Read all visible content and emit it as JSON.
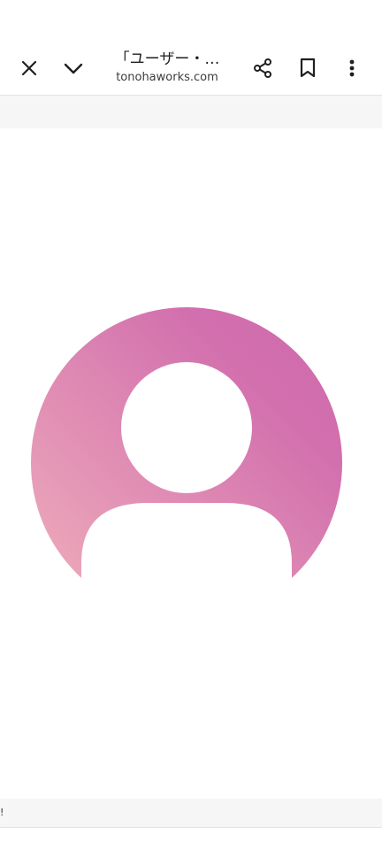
{
  "toolbar": {
    "close_icon": "close-icon",
    "collapse_icon": "chevron-down-icon",
    "title": "「ユーザー・…",
    "domain": "tonohaworks.com",
    "share_icon": "share-icon",
    "bookmark_icon": "bookmark-icon",
    "menu_icon": "more-vertical-icon"
  },
  "content": {
    "avatar_icon": "default-user-avatar-icon",
    "avatar_gradient": [
      "#f0b0bb",
      "#d26fae"
    ]
  },
  "bottom": {
    "partial_mark": "!"
  },
  "colors": {
    "toolbar_bg": "#ffffff",
    "strip_bg": "#f6f6f6",
    "icon": "#1f1f1f"
  }
}
